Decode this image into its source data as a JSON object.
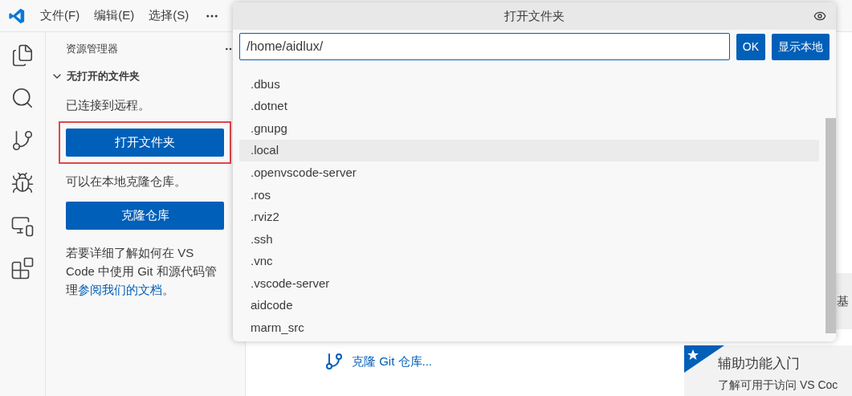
{
  "menu": [
    "文件(F)",
    "编辑(E)",
    "选择(S)"
  ],
  "sidebar": {
    "title": "资源管理器",
    "section": {
      "label": "无打开的文件夹",
      "expanded": true
    },
    "connected_text": "已连接到远程。",
    "open_folder_button": {
      "label": "打开文件夹",
      "highlighted": true
    },
    "clone_text": "可以在本地克隆仓库。",
    "clone_button": "克隆仓库",
    "help_text": "若要详细了解如何在 VS Code 中使用 Git 和源代码管理",
    "help_link": "参阅我们的文档",
    "help_end": "。"
  },
  "dialog": {
    "title": "打开文件夹",
    "path": "/home/aidlux/",
    "buttons": [
      "OK",
      "显示本地"
    ],
    "items": [
      {
        "label": ".dbus",
        "selected": false
      },
      {
        "label": ".dotnet",
        "selected": false
      },
      {
        "label": ".gnupg",
        "selected": false
      },
      {
        "label": ".local",
        "selected": true
      },
      {
        "label": ".openvscode-server",
        "selected": false
      },
      {
        "label": ".ros",
        "selected": false
      },
      {
        "label": ".rviz2",
        "selected": false
      },
      {
        "label": ".ssh",
        "selected": false
      },
      {
        "label": ".vnc",
        "selected": false
      },
      {
        "label": ".vscode-server",
        "selected": false
      },
      {
        "label": "aidcode",
        "selected": false
      },
      {
        "label": "marm_src",
        "selected": false
      }
    ]
  },
  "welcome": {
    "clone_link": "克隆 Git 仓库...",
    "side_text": "基",
    "card_title": "辅助功能入门",
    "card_text": "了解可用于访问 VS Coc"
  }
}
